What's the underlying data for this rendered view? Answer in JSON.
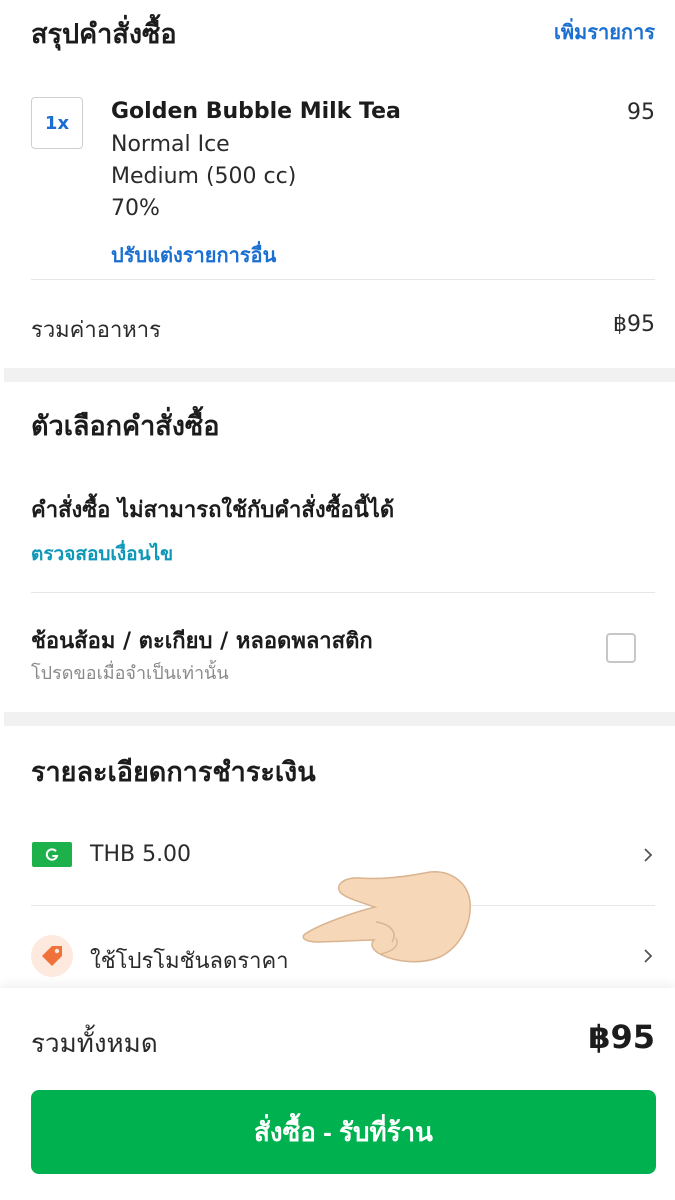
{
  "summary": {
    "title": "สรุปคำสั่งซื้อ",
    "add_items_link": "เพิ่มรายการ",
    "item": {
      "qty": "1x",
      "name": "Golden Bubble Milk Tea",
      "options": [
        "Normal Ice",
        "Medium (500 cc)",
        "70%"
      ],
      "price": "95",
      "edit_link": "ปรับแต่งรายการอื่น"
    },
    "subtotal_label": "รวมค่าอาหาร",
    "subtotal_value": "฿95"
  },
  "order_options": {
    "title": "ตัวเลือกคำสั่งซื้อ",
    "notice": "คำสั่งซื้อ ไม่สามารถใช้กับคำสั่งซื้อนี้ได้",
    "check_conditions_link": "ตรวจสอบเงื่อนไข",
    "cutlery_label": "ช้อนส้อม / ตะเกียบ / หลอดพลาสติก",
    "cutlery_hint": "โปรดขอเมื่อจำเป็นเท่านั้น",
    "cutlery_checked": false
  },
  "payment": {
    "title": "รายละเอียดการชำระเงิน",
    "method_icon": "grabpay-g-icon",
    "method_amount": "THB 5.00",
    "promo_icon": "tag-icon",
    "promo_label": "ใช้โปรโมชันลดราคา"
  },
  "footer": {
    "total_label": "รวมทั้งหมด",
    "total_value": "฿95",
    "order_button": "สั่งซื้อ - รับที่ร้าน"
  },
  "colors": {
    "brand_green": "#00b14f",
    "link_blue": "#1a6fd0",
    "link_teal": "#0d97b8",
    "promo_orange": "#f0713a"
  }
}
